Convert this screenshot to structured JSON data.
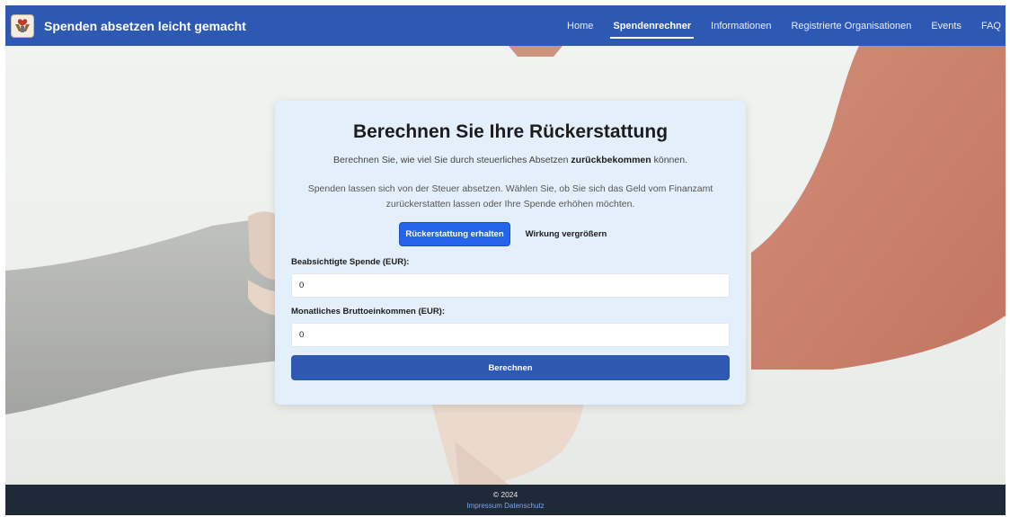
{
  "navbar": {
    "brand": "Spenden absetzen leicht gemacht",
    "links": [
      {
        "label": "Home"
      },
      {
        "label": "Spendenrechner"
      },
      {
        "label": "Informationen"
      },
      {
        "label": "Registrierte Organisationen"
      },
      {
        "label": "Events"
      },
      {
        "label": "FAQ"
      }
    ],
    "active": "Spendenrechner"
  },
  "card": {
    "title": "Berechnen Sie Ihre Rückerstattung",
    "subtitle_pre": "Berechnen Sie, wie viel Sie durch steuerliches Absetzen ",
    "subtitle_bold": "zurückbekommen",
    "subtitle_post": " können.",
    "description": "Spenden lassen sich von der Steuer absetzen. Wählen Sie, ob Sie sich das Geld vom Finanzamt zurückerstatten lassen oder Ihre Spende erhöhen möchten.",
    "toggle": {
      "option_refund": "Rückerstattung erhalten",
      "option_increase": "Wirkung vergrößern",
      "selected": "Rückerstattung erhalten"
    },
    "donation": {
      "label": "Beabsichtigte Spende (EUR):",
      "value": "0"
    },
    "income": {
      "label": "Monatliches Bruttoeinkommen (EUR):",
      "value": "0"
    },
    "submit_label": "Berechnen"
  },
  "footer": {
    "copyright": "© 2024",
    "links": [
      {
        "label": "Impressum"
      },
      {
        "label": "Datenschutz"
      }
    ]
  },
  "colors": {
    "navbar": "#2e59b3",
    "primary_button": "#2563eb",
    "card_background": "#e3f0fb",
    "footer": "#1f2937",
    "footer_link": "#7ca6e8"
  },
  "icons": {
    "brand_logo": "hands-heart-logo-icon"
  }
}
